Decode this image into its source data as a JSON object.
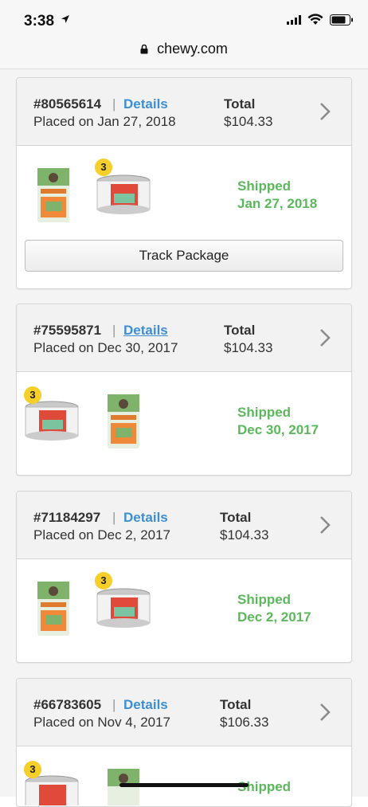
{
  "status_bar": {
    "time": "3:38"
  },
  "browser": {
    "url": "chewy.com"
  },
  "orders": [
    {
      "number": "#80565614",
      "details_label": "Details",
      "placed": "Placed on Jan 27, 2018",
      "total_label": "Total",
      "total_value": "$104.33",
      "status": "Shipped",
      "status_date": "Jan 27, 2018",
      "bag_qty": "",
      "can_qty": "3",
      "track_label": "Track Package"
    },
    {
      "number": "#75595871",
      "details_label": "Details",
      "placed": "Placed on Dec 30, 2017",
      "total_label": "Total",
      "total_value": "$104.33",
      "status": "Shipped",
      "status_date": "Dec 30, 2017",
      "can_qty": "3"
    },
    {
      "number": "#71184297",
      "details_label": "Details",
      "placed": "Placed on Dec 2, 2017",
      "total_label": "Total",
      "total_value": "$104.33",
      "status": "Shipped",
      "status_date": "Dec 2, 2017",
      "can_qty": "3"
    },
    {
      "number": "#66783605",
      "details_label": "Details",
      "placed": "Placed on Nov 4, 2017",
      "total_label": "Total",
      "total_value": "$106.33",
      "status": "Shipped",
      "can_qty": "3"
    }
  ],
  "colors": {
    "link": "#3d8fd1",
    "shipped": "#5cb85c",
    "badge": "#f6cf2b"
  }
}
